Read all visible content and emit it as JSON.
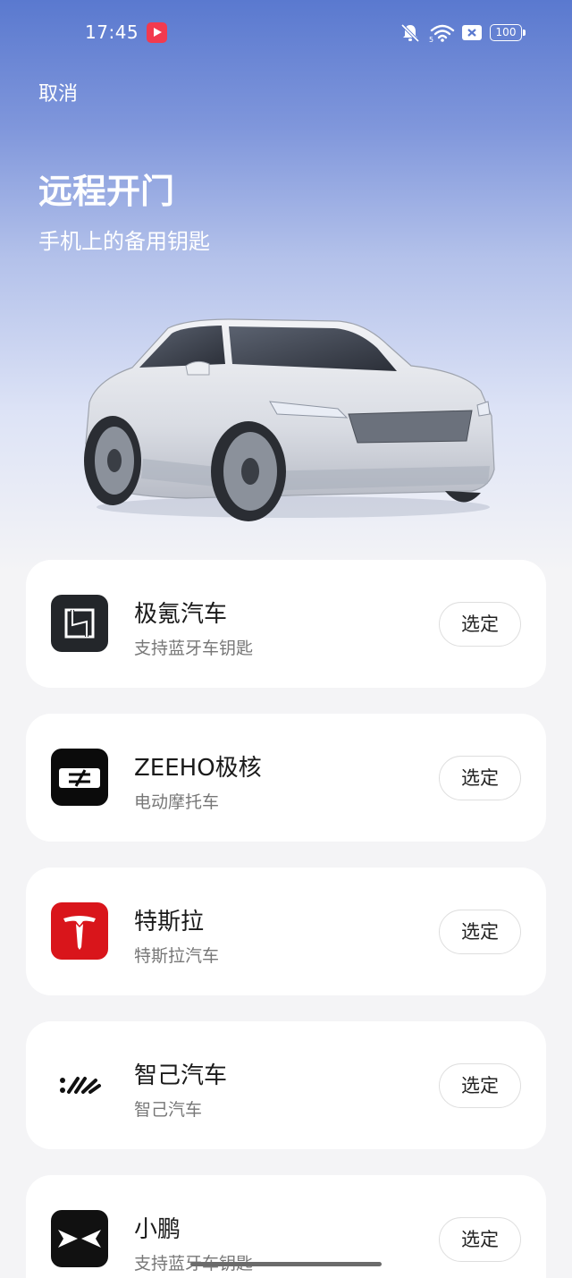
{
  "status_bar": {
    "time": "17:45",
    "battery": "100",
    "icons": [
      "screen-record-icon",
      "mute-icon",
      "wifi-icon",
      "sim-x-icon",
      "battery-icon"
    ]
  },
  "header": {
    "cancel_label": "取消",
    "title": "远程开门",
    "subtitle": "手机上的备用钥匙"
  },
  "brands": [
    {
      "name": "极氪汽车",
      "desc": "支持蓝牙车钥匙",
      "button": "选定",
      "logo": "zeekr-logo"
    },
    {
      "name": "ZEEHO极核",
      "desc": "电动摩托车",
      "button": "选定",
      "logo": "zeeho-logo"
    },
    {
      "name": "特斯拉",
      "desc": "特斯拉汽车",
      "button": "选定",
      "logo": "tesla-logo"
    },
    {
      "name": "智己汽车",
      "desc": "智己汽车",
      "button": "选定",
      "logo": "im-motors-logo"
    },
    {
      "name": "小鹏",
      "desc": "支持蓝牙车钥匙",
      "button": "选定",
      "logo": "xpeng-logo"
    }
  ],
  "colors": {
    "hero_top": "#5a79cf",
    "background": "#f4f4f6",
    "tesla_red": "#d9151b",
    "record_red": "#f23a4f"
  }
}
